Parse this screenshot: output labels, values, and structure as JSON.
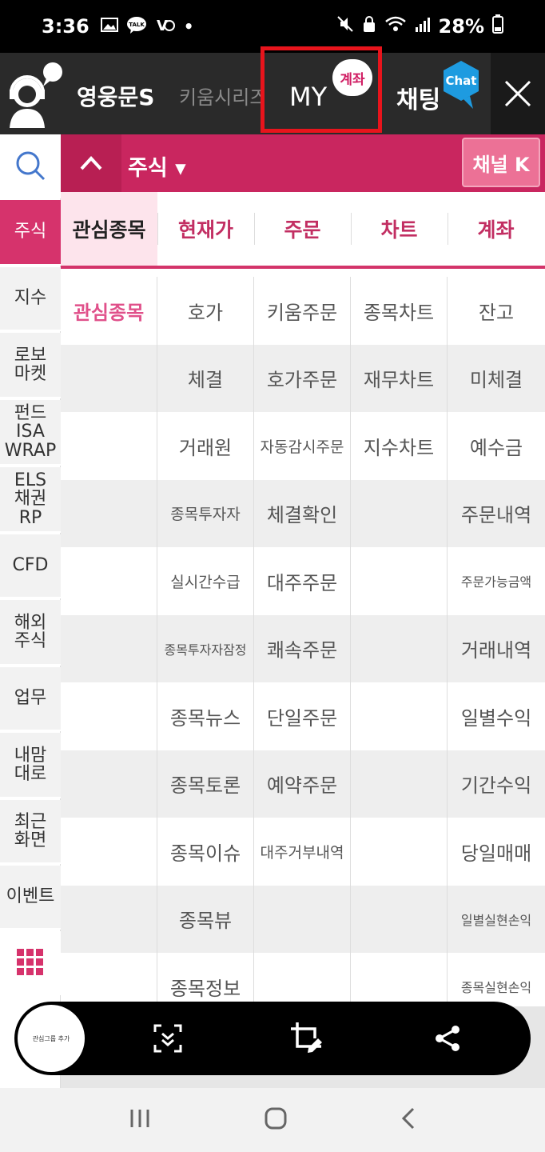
{
  "status_bar": {
    "time": "3:36",
    "battery": "28%"
  },
  "top_bar": {
    "brand": "영웅문S",
    "series": "키움시리즈",
    "my_label": "MY",
    "my_badge": "계좌",
    "chat_label": "채팅",
    "chat_badge": "Chat"
  },
  "left_rail": {
    "items": [
      {
        "label": "주식",
        "active": true
      },
      {
        "label": "지수"
      },
      {
        "label": "로보\n마켓"
      },
      {
        "label": "펀드\nISA\nWRAP"
      },
      {
        "label": "ELS\n채권\nRP"
      },
      {
        "label": "CFD"
      },
      {
        "label": "해외\n주식"
      },
      {
        "label": "업무"
      },
      {
        "label": "내맘\n대로"
      },
      {
        "label": "최근\n화면"
      },
      {
        "label": "이벤트"
      }
    ]
  },
  "sub_header": {
    "title": "주식 ▾",
    "channel_button": "채널 K"
  },
  "tabs": [
    "관심종목",
    "현재가",
    "주문",
    "차트",
    "계좌"
  ],
  "grid": {
    "rows": [
      [
        "관심종목",
        "호가",
        "키움주문",
        "종목차트",
        "잔고"
      ],
      [
        "",
        "체결",
        "호가주문",
        "재무차트",
        "미체결"
      ],
      [
        "",
        "거래원",
        "자동감시주문",
        "지수차트",
        "예수금"
      ],
      [
        "",
        "종목투자자",
        "체결확인",
        "",
        "주문내역"
      ],
      [
        "",
        "실시간수급",
        "대주주문",
        "",
        "주문가능금액"
      ],
      [
        "",
        "종목투자자잠정",
        "쾌속주문",
        "",
        "거래내역"
      ],
      [
        "",
        "종목뉴스",
        "단일주문",
        "",
        "일별수익"
      ],
      [
        "",
        "종목토론",
        "예약주문",
        "",
        "기간수익"
      ],
      [
        "",
        "종목이슈",
        "대주거부내역",
        "",
        "당일매매"
      ],
      [
        "",
        "종목뷰",
        "",
        "",
        "일별실현손익"
      ],
      [
        "",
        "종목정보",
        "",
        "",
        "종목실현손익"
      ]
    ]
  },
  "screenshot_toolbar": {
    "thumb_text": "관심그룹 추가"
  },
  "colors": {
    "accent": "#c9265f",
    "highlight_box": "#e8141c",
    "chat_blue": "#1e9be0"
  }
}
